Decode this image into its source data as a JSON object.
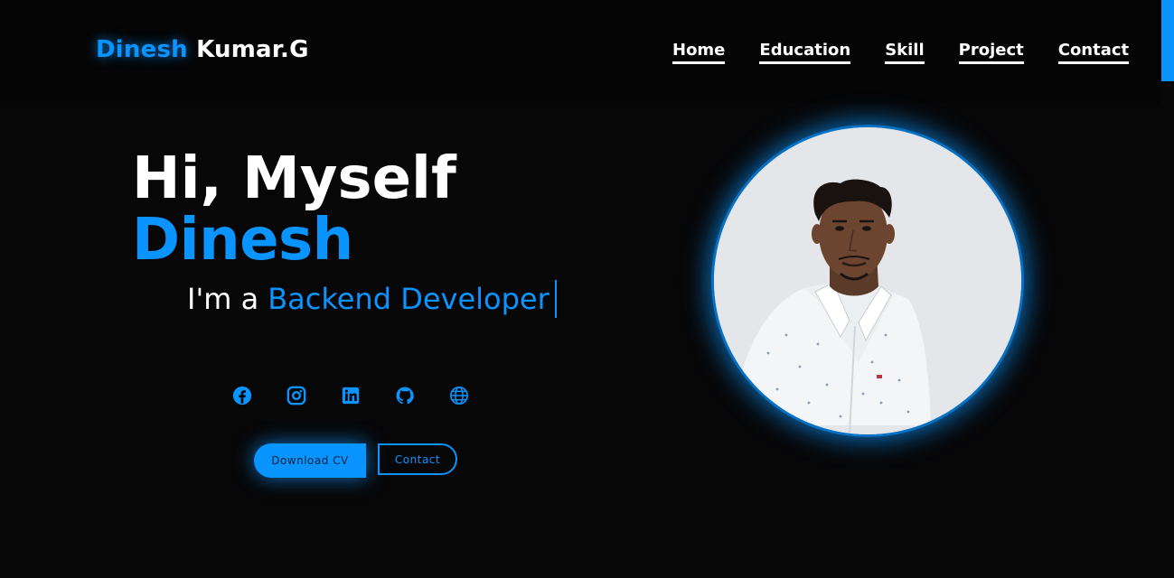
{
  "brand": {
    "first_name": "Dinesh",
    "last_name": "Kumar.G"
  },
  "nav": {
    "items": [
      {
        "label": "Home"
      },
      {
        "label": "Education"
      },
      {
        "label": "Skill"
      },
      {
        "label": "Project"
      },
      {
        "label": "Contact"
      }
    ]
  },
  "hero": {
    "greeting": "Hi, Myself",
    "name": "Dinesh",
    "role_prefix": "I'm a",
    "role_typed": "Backend Developer"
  },
  "socials": [
    {
      "icon": "facebook-icon"
    },
    {
      "icon": "instagram-icon"
    },
    {
      "icon": "linkedin-icon"
    },
    {
      "icon": "github-icon"
    },
    {
      "icon": "globe-icon"
    }
  ],
  "actions": {
    "download_label": "Download CV",
    "contact_label": "Contact"
  },
  "theme": {
    "accent": "#0a94ff",
    "background": "#070708",
    "header_background": "#050505",
    "avatar_background": "#e4e6ea"
  }
}
